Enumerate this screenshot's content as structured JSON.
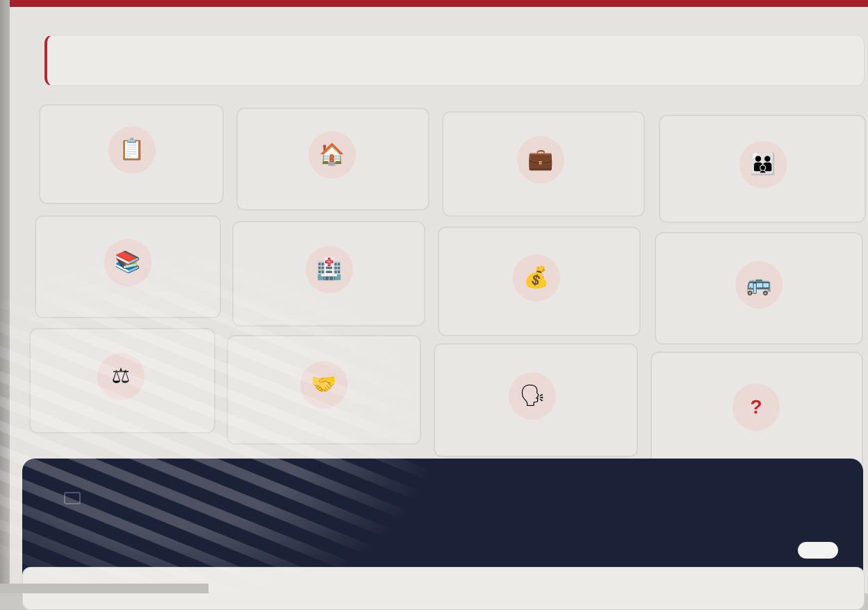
{
  "colors": {
    "accent": "#a4212c",
    "panel": "#1b2137",
    "icon_circle": "#ebd9d6",
    "question_mark": "#c4262f"
  },
  "search": {
    "value": ""
  },
  "categories": [
    {
      "icon": "clipboard-icon",
      "glyph": "📋"
    },
    {
      "icon": "house-icon",
      "glyph": "🏠"
    },
    {
      "icon": "briefcase-icon",
      "glyph": "💼"
    },
    {
      "icon": "family-icon",
      "glyph": "👪"
    },
    {
      "icon": "books-icon",
      "glyph": "📚"
    },
    {
      "icon": "hospital-icon",
      "glyph": "🏥"
    },
    {
      "icon": "money-bag-icon",
      "glyph": "💰"
    },
    {
      "icon": "bus-icon",
      "glyph": "🚌"
    },
    {
      "icon": "scales-icon",
      "glyph": "⚖"
    },
    {
      "icon": "handshake-icon",
      "glyph": "🤝"
    },
    {
      "icon": "speaking-head-icon",
      "glyph": "🗣"
    },
    {
      "icon": "question-icon",
      "glyph": "?"
    }
  ],
  "panel": {
    "icon": "image-icon"
  }
}
